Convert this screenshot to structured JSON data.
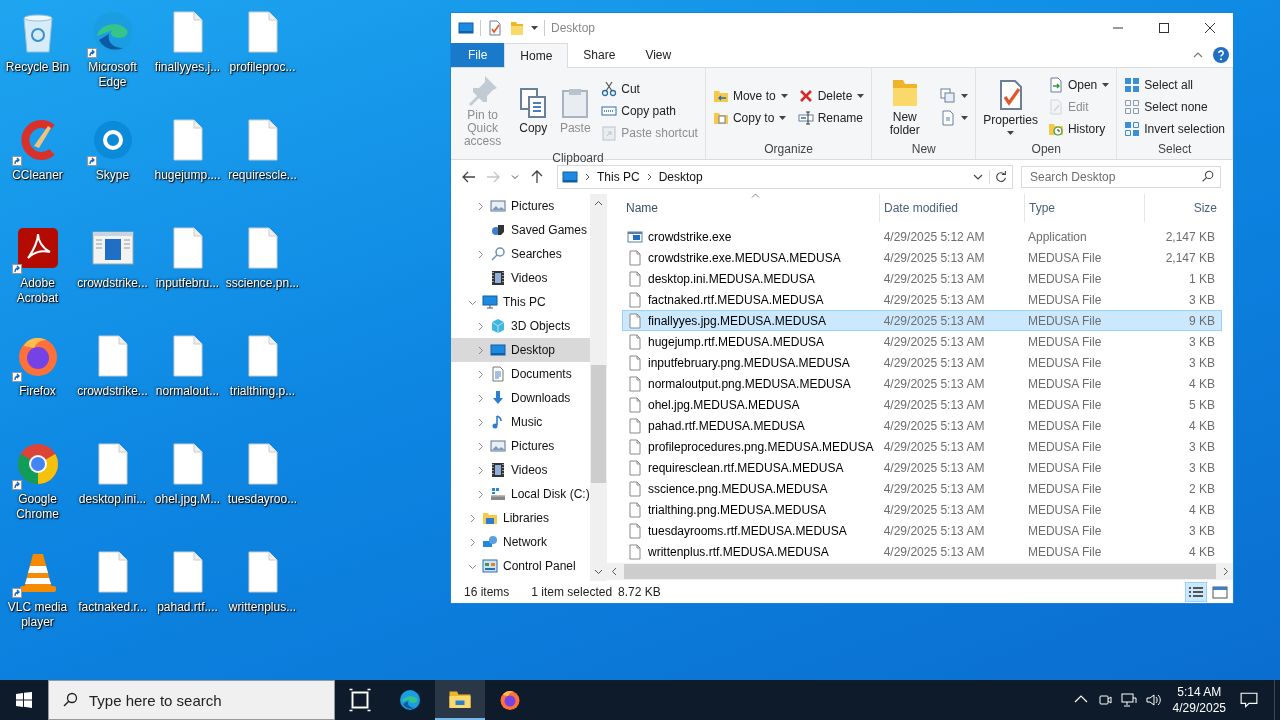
{
  "desktop": {
    "icons": [
      {
        "label": "Recycle Bin",
        "kind": "recycle",
        "shortcut": false
      },
      {
        "label": "CCleaner",
        "kind": "ccleaner",
        "shortcut": true
      },
      {
        "label": "Adobe Acrobat",
        "kind": "acrobat",
        "shortcut": true
      },
      {
        "label": "Firefox",
        "kind": "firefox",
        "shortcut": true
      },
      {
        "label": "Google Chrome",
        "kind": "chrome",
        "shortcut": true
      },
      {
        "label": "VLC media player",
        "kind": "vlc",
        "shortcut": true
      },
      {
        "label": "Microsoft Edge",
        "kind": "edge",
        "shortcut": true
      },
      {
        "label": "Skype",
        "kind": "skype",
        "shortcut": true
      },
      {
        "label": "crowdstrike...",
        "kind": "app",
        "shortcut": false
      },
      {
        "label": "crowdstrike...",
        "kind": "file",
        "shortcut": false
      },
      {
        "label": "desktop.ini...",
        "kind": "file",
        "shortcut": false
      },
      {
        "label": "factnaked.r...",
        "kind": "file",
        "shortcut": false
      },
      {
        "label": "finallyyes.j...",
        "kind": "file",
        "shortcut": false
      },
      {
        "label": "hugejump....",
        "kind": "file",
        "shortcut": false
      },
      {
        "label": "inputfebru...",
        "kind": "file",
        "shortcut": false
      },
      {
        "label": "normalout...",
        "kind": "file",
        "shortcut": false
      },
      {
        "label": "ohel.jpg.M...",
        "kind": "file",
        "shortcut": false
      },
      {
        "label": "pahad.rtf....",
        "kind": "file",
        "shortcut": false
      },
      {
        "label": "profileproc...",
        "kind": "file",
        "shortcut": false
      },
      {
        "label": "requirescle...",
        "kind": "file",
        "shortcut": false
      },
      {
        "label": "sscience.pn...",
        "kind": "file",
        "shortcut": false
      },
      {
        "label": "trialthing.p...",
        "kind": "file",
        "shortcut": false
      },
      {
        "label": "tuesdayroo...",
        "kind": "file",
        "shortcut": false
      },
      {
        "label": "writtenplus...",
        "kind": "file",
        "shortcut": false
      }
    ]
  },
  "explorer": {
    "title": "Desktop",
    "menu_tabs": [
      {
        "label": "File",
        "kind": "file",
        "selected": false
      },
      {
        "label": "Home",
        "kind": "tab",
        "selected": true
      },
      {
        "label": "Share",
        "kind": "tab",
        "selected": false
      },
      {
        "label": "View",
        "kind": "tab",
        "selected": false
      }
    ],
    "ribbon": [
      {
        "label": "Clipboard",
        "columns": [
          [
            {
              "label": "Pin to Quick access",
              "kind": "pin",
              "disabled": true,
              "dropdown": false
            }
          ],
          [
            {
              "label": "Copy",
              "kind": "copy",
              "disabled": false,
              "dropdown": false
            }
          ],
          [
            {
              "label": "Paste",
              "kind": "paste",
              "disabled": true,
              "dropdown": false
            }
          ],
          [
            {
              "label": "Cut",
              "kind": "cut",
              "disabled": false,
              "dropdown": false
            },
            {
              "label": "Copy path",
              "kind": "copypath",
              "disabled": false,
              "dropdown": false
            },
            {
              "label": "Paste shortcut",
              "kind": "pasteshortcut",
              "disabled": true,
              "dropdown": false
            }
          ]
        ]
      },
      {
        "label": "Organize",
        "columns": [
          [
            {
              "label": "Move to",
              "kind": "moveto",
              "disabled": false,
              "dropdown": true
            },
            {
              "label": "Copy to",
              "kind": "copyto",
              "disabled": false,
              "dropdown": true
            }
          ],
          [
            {
              "label": "Delete",
              "kind": "delete",
              "disabled": false,
              "dropdown": true
            },
            {
              "label": "Rename",
              "kind": "rename",
              "disabled": false,
              "dropdown": false
            }
          ]
        ]
      },
      {
        "label": "New",
        "columns": [
          [
            {
              "label": "New folder",
              "kind": "newfolder",
              "disabled": false,
              "dropdown": false
            }
          ],
          [
            {
              "kind": "newitem",
              "disabled": false,
              "dropdown": true
            },
            {
              "kind": "easyaccess",
              "disabled": false,
              "dropdown": true
            }
          ]
        ]
      },
      {
        "label": "Open",
        "columns": [
          [
            {
              "label": "Properties",
              "kind": "properties",
              "disabled": false,
              "dropdown": true
            }
          ],
          [
            {
              "label": "Open",
              "kind": "open",
              "disabled": false,
              "dropdown": true
            },
            {
              "label": "Edit",
              "kind": "edit",
              "disabled": true,
              "dropdown": false
            },
            {
              "label": "History",
              "kind": "history",
              "disabled": false,
              "dropdown": false
            }
          ]
        ]
      },
      {
        "label": "Select",
        "columns": [
          [
            {
              "label": "Select all",
              "kind": "selectall",
              "disabled": false,
              "dropdown": false
            },
            {
              "label": "Select none",
              "kind": "selectnone",
              "disabled": false,
              "dropdown": false
            },
            {
              "label": "Invert selection",
              "kind": "invert",
              "disabled": false,
              "dropdown": false
            }
          ]
        ]
      }
    ],
    "nav_buttons": [
      {
        "kind": "back",
        "disabled": false
      },
      {
        "kind": "forward",
        "disabled": true
      },
      {
        "kind": "recent",
        "disabled": false
      },
      {
        "kind": "up",
        "disabled": false
      }
    ],
    "address": {
      "path": [
        "This PC",
        "Desktop"
      ]
    },
    "search": {
      "placeholder": "Search Desktop"
    },
    "nav": {
      "scrolled_items": [
        {
          "label": "Pictures",
          "kind": "pictures",
          "expanded": false,
          "selected": false
        },
        {
          "label": "Saved Games",
          "kind": "games",
          "selected": false
        },
        {
          "label": "Searches",
          "kind": "search",
          "expanded": false,
          "selected": false
        },
        {
          "label": "Videos",
          "kind": "videos",
          "selected": false
        }
      ],
      "items": [
        {
          "label": "This PC",
          "kind": "pc",
          "expanded": true,
          "selected": false,
          "children": [
            {
              "label": "3D Objects",
              "kind": "objects3d",
              "expanded": false,
              "selected": false
            },
            {
              "label": "Desktop",
              "kind": "desktop",
              "expanded": false,
              "selected": true
            },
            {
              "label": "Documents",
              "kind": "documents",
              "expanded": false,
              "selected": false
            },
            {
              "label": "Downloads",
              "kind": "downloads",
              "expanded": false,
              "selected": false
            },
            {
              "label": "Music",
              "kind": "music",
              "expanded": false,
              "selected": false
            },
            {
              "label": "Pictures",
              "kind": "pictures",
              "expanded": false,
              "selected": false
            },
            {
              "label": "Videos",
              "kind": "videos",
              "expanded": false,
              "selected": false
            },
            {
              "label": "Local Disk (C:)",
              "kind": "disk",
              "expanded": false,
              "selected": false
            }
          ]
        },
        {
          "label": "Libraries",
          "kind": "libraries",
          "expanded": false,
          "selected": false
        },
        {
          "label": "Network",
          "kind": "network",
          "expanded": false,
          "selected": false
        },
        {
          "label": "Control Panel",
          "kind": "control",
          "expanded": true,
          "selected": false
        }
      ]
    },
    "columns": [
      {
        "label": "Name",
        "sorted": true
      },
      {
        "label": "Date modified",
        "sorted": false
      },
      {
        "label": "Type",
        "sorted": false
      },
      {
        "label": "Size",
        "sorted": false
      }
    ],
    "files": [
      {
        "name": "crowdstrike.exe",
        "kind": "app",
        "date": "4/29/2025 5:12 AM",
        "type": "Application",
        "size": "2,147 KB",
        "selected": false
      },
      {
        "name": "crowdstrike.exe.MEDUSA.MEDUSA",
        "kind": "file",
        "date": "4/29/2025 5:13 AM",
        "type": "MEDUSA File",
        "size": "2,147 KB",
        "selected": false
      },
      {
        "name": "desktop.ini.MEDUSA.MEDUSA",
        "kind": "file",
        "date": "4/29/2025 5:13 AM",
        "type": "MEDUSA File",
        "size": "1 KB",
        "selected": false
      },
      {
        "name": "factnaked.rtf.MEDUSA.MEDUSA",
        "kind": "file",
        "date": "4/29/2025 5:13 AM",
        "type": "MEDUSA File",
        "size": "3 KB",
        "selected": false
      },
      {
        "name": "finallyyes.jpg.MEDUSA.MEDUSA",
        "kind": "file",
        "date": "4/29/2025 5:13 AM",
        "type": "MEDUSA File",
        "size": "9 KB",
        "selected": true
      },
      {
        "name": "hugejump.rtf.MEDUSA.MEDUSA",
        "kind": "file",
        "date": "4/29/2025 5:13 AM",
        "type": "MEDUSA File",
        "size": "3 KB",
        "selected": false
      },
      {
        "name": "inputfebruary.png.MEDUSA.MEDUSA",
        "kind": "file",
        "date": "4/29/2025 5:13 AM",
        "type": "MEDUSA File",
        "size": "3 KB",
        "selected": false
      },
      {
        "name": "normaloutput.png.MEDUSA.MEDUSA",
        "kind": "file",
        "date": "4/29/2025 5:13 AM",
        "type": "MEDUSA File",
        "size": "4 KB",
        "selected": false
      },
      {
        "name": "ohel.jpg.MEDUSA.MEDUSA",
        "kind": "file",
        "date": "4/29/2025 5:13 AM",
        "type": "MEDUSA File",
        "size": "5 KB",
        "selected": false
      },
      {
        "name": "pahad.rtf.MEDUSA.MEDUSA",
        "kind": "file",
        "date": "4/29/2025 5:13 AM",
        "type": "MEDUSA File",
        "size": "4 KB",
        "selected": false
      },
      {
        "name": "profileprocedures.png.MEDUSA.MEDUSA",
        "kind": "file",
        "date": "4/29/2025 5:13 AM",
        "type": "MEDUSA File",
        "size": "3 KB",
        "selected": false
      },
      {
        "name": "requiresclean.rtf.MEDUSA.MEDUSA",
        "kind": "file",
        "date": "4/29/2025 5:13 AM",
        "type": "MEDUSA File",
        "size": "3 KB",
        "selected": false
      },
      {
        "name": "sscience.png.MEDUSA.MEDUSA",
        "kind": "file",
        "date": "4/29/2025 5:13 AM",
        "type": "MEDUSA File",
        "size": "2 KB",
        "selected": false
      },
      {
        "name": "trialthing.png.MEDUSA.MEDUSA",
        "kind": "file",
        "date": "4/29/2025 5:13 AM",
        "type": "MEDUSA File",
        "size": "4 KB",
        "selected": false
      },
      {
        "name": "tuesdayrooms.rtf.MEDUSA.MEDUSA",
        "kind": "file",
        "date": "4/29/2025 5:13 AM",
        "type": "MEDUSA File",
        "size": "3 KB",
        "selected": false
      },
      {
        "name": "writtenplus.rtf.MEDUSA.MEDUSA",
        "kind": "file",
        "date": "4/29/2025 5:13 AM",
        "type": "MEDUSA File",
        "size": "4 KB",
        "selected": false
      }
    ],
    "status": {
      "count": "16 items",
      "selection": "1 item selected",
      "size": "8.72 KB"
    },
    "views": [
      {
        "kind": "details",
        "selected": true
      },
      {
        "kind": "large_icons",
        "selected": false
      }
    ]
  },
  "taskbar": {
    "search": {
      "placeholder": "Type here to search"
    },
    "apps": [
      {
        "kind": "taskview",
        "active": false
      },
      {
        "kind": "edge",
        "active": false
      },
      {
        "kind": "explorer",
        "active": true
      },
      {
        "kind": "firefox",
        "active": false
      }
    ],
    "time": "5:14 AM",
    "date": "4/29/2025"
  }
}
